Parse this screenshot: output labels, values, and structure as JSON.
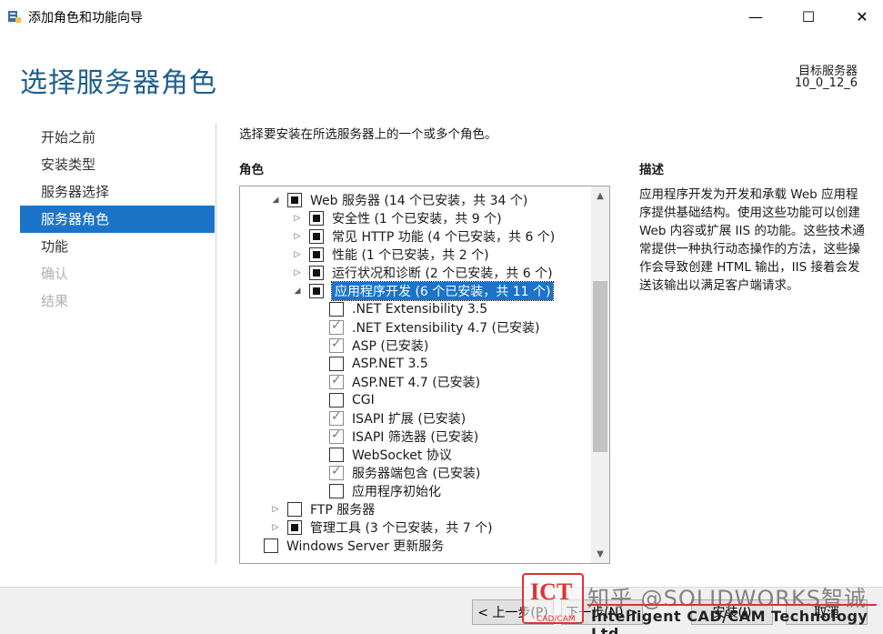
{
  "window": {
    "title": "添加角色和功能向导",
    "minimize": "—",
    "maximize": "☐",
    "close": "✕"
  },
  "header": {
    "title": "选择服务器角色",
    "target_label": "目标服务器",
    "target_value": "10_0_12_6"
  },
  "nav": {
    "items": [
      {
        "label": "开始之前",
        "state": "normal"
      },
      {
        "label": "安装类型",
        "state": "normal"
      },
      {
        "label": "服务器选择",
        "state": "normal"
      },
      {
        "label": "服务器角色",
        "state": "active"
      },
      {
        "label": "功能",
        "state": "normal"
      },
      {
        "label": "确认",
        "state": "disabled"
      },
      {
        "label": "结果",
        "state": "disabled"
      }
    ]
  },
  "content": {
    "instruction": "选择要安装在所选服务器上的一个或多个角色。",
    "roles_label": "角色",
    "description_label": "描述",
    "description_text": "应用程序开发为开发和承载 Web 应用程序提供基础结构。使用这些功能可以创建 Web 内容或扩展 IIS 的功能。这些技术通常提供一种执行动态操作的方法，这些操作会导致创建 HTML 输出，IIS 接着会发送该输出以满足客户端请求。"
  },
  "tree": [
    {
      "label": "Web 服务器 (14 个已安装，共 34 个)",
      "level": 0,
      "expander": "expanded",
      "check": "partial"
    },
    {
      "label": "安全性 (1 个已安装，共 9 个)",
      "level": 1,
      "expander": "collapsed",
      "check": "partial"
    },
    {
      "label": "常见 HTTP 功能 (4 个已安装，共 6 个)",
      "level": 1,
      "expander": "collapsed",
      "check": "partial"
    },
    {
      "label": "性能 (1 个已安装，共 2 个)",
      "level": 1,
      "expander": "collapsed",
      "check": "partial"
    },
    {
      "label": "运行状况和诊断 (2 个已安装，共 6 个)",
      "level": 1,
      "expander": "collapsed",
      "check": "partial"
    },
    {
      "label": "应用程序开发 (6 个已安装，共 11 个)",
      "level": 1,
      "expander": "expanded",
      "check": "partial",
      "selected": true
    },
    {
      "label": ".NET Extensibility 3.5",
      "level": 2,
      "expander": "none",
      "check": "unchecked"
    },
    {
      "label": ".NET Extensibility 4.7 (已安装)",
      "level": 2,
      "expander": "none",
      "check": "checked"
    },
    {
      "label": "ASP (已安装)",
      "level": 2,
      "expander": "none",
      "check": "checked"
    },
    {
      "label": "ASP.NET 3.5",
      "level": 2,
      "expander": "none",
      "check": "unchecked"
    },
    {
      "label": "ASP.NET 4.7 (已安装)",
      "level": 2,
      "expander": "none",
      "check": "checked"
    },
    {
      "label": "CGI",
      "level": 2,
      "expander": "none",
      "check": "unchecked"
    },
    {
      "label": "ISAPI 扩展 (已安装)",
      "level": 2,
      "expander": "none",
      "check": "checked"
    },
    {
      "label": "ISAPI 筛选器 (已安装)",
      "level": 2,
      "expander": "none",
      "check": "checked"
    },
    {
      "label": "WebSocket 协议",
      "level": 2,
      "expander": "none",
      "check": "unchecked"
    },
    {
      "label": "服务器端包含 (已安装)",
      "level": 2,
      "expander": "none",
      "check": "checked"
    },
    {
      "label": "应用程序初始化",
      "level": 2,
      "expander": "none",
      "check": "unchecked"
    },
    {
      "label": "FTP 服务器",
      "level": 0,
      "expander": "collapsed",
      "check": "unchecked"
    },
    {
      "label": "管理工具 (3 个已安装，共 7 个)",
      "level": 0,
      "expander": "collapsed",
      "check": "partial"
    },
    {
      "label": "Windows Server 更新服务",
      "level": -1,
      "expander": "none",
      "check": "unchecked"
    }
  ],
  "scrollbar": {
    "up": "▲",
    "down": "▼"
  },
  "buttons": {
    "prev": "< 上一步(P)",
    "next": "下一步(N) >",
    "install": "安装(I)",
    "cancel": "取消"
  },
  "watermark": {
    "logo": "ICT",
    "logo_small": "CAD/CAM",
    "cn": "知乎 @SOLIDWORKS智诚",
    "en": "Intelligent CAD/CAM Technology Ltd."
  },
  "colors": {
    "title_blue": "#1f5f8b",
    "selection_blue": "#1c74c8",
    "footer_gray": "#f0f0f0",
    "watermark_red": "#d33333"
  }
}
